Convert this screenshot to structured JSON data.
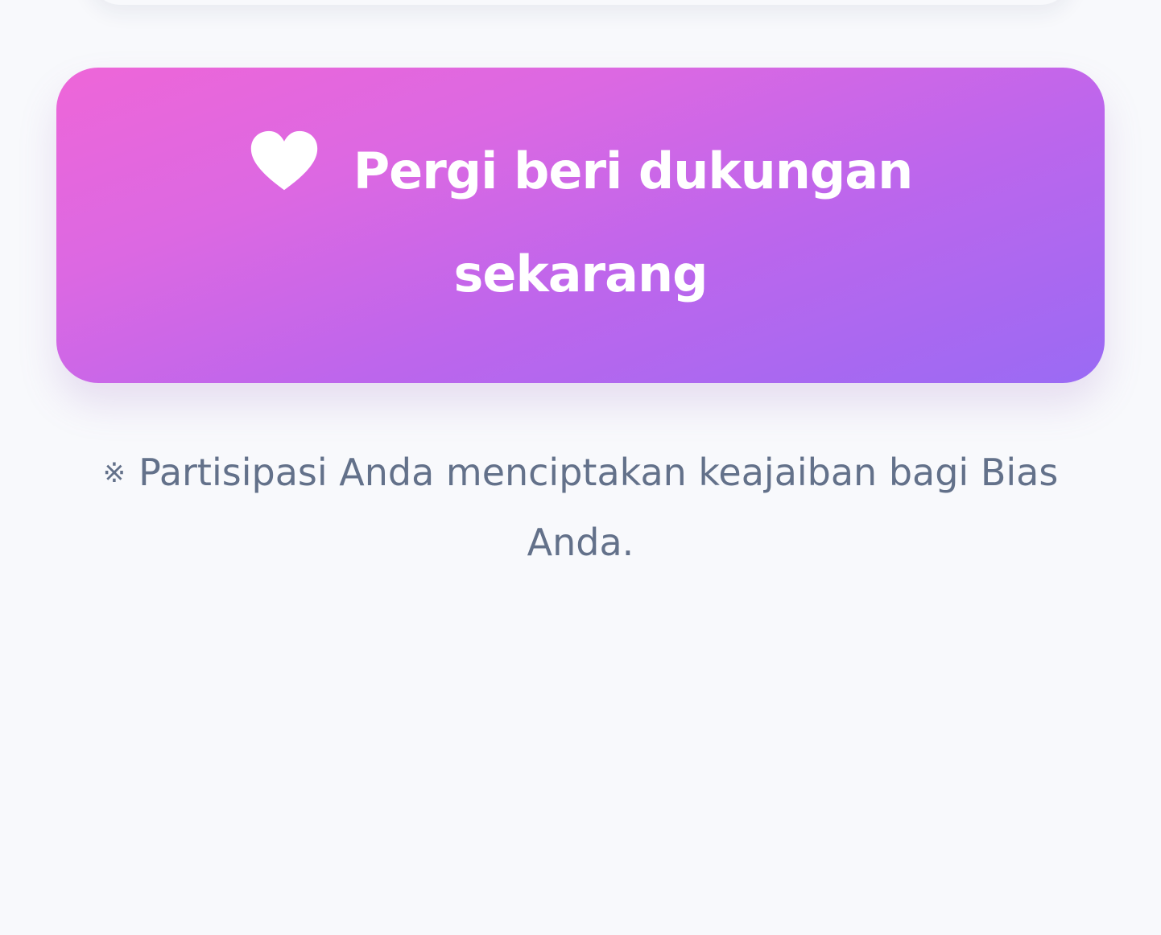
{
  "cta": {
    "label": "Pergi beri dukungan sekarang",
    "icon": "heart-icon",
    "gradient_colors": [
      "#ee66d8",
      "#dc68e2",
      "#bd66ec",
      "#9a6af4"
    ]
  },
  "note": {
    "symbol": "※",
    "text": "Partisipasi Anda menciptakan keajaiban bagi Bias Anda."
  },
  "colors": {
    "background": "#f8f9fc",
    "note_text": "#63718a"
  }
}
